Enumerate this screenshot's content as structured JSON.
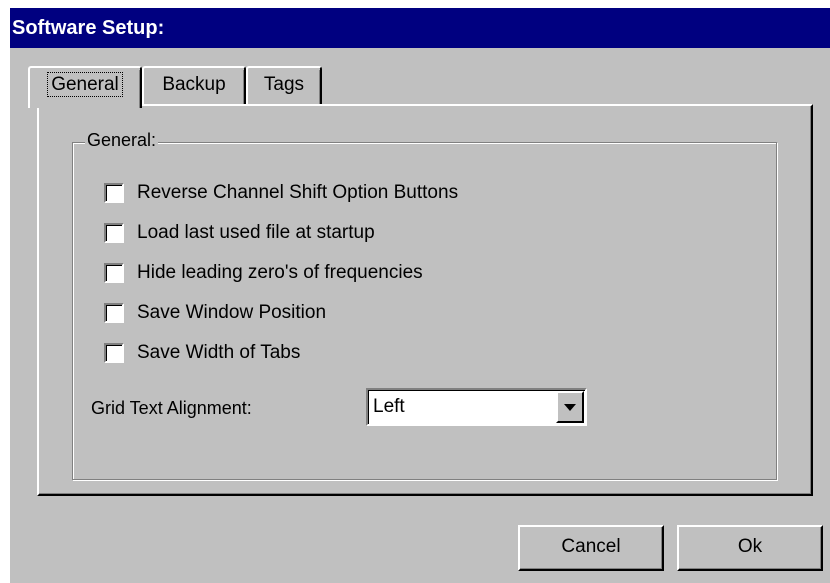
{
  "window": {
    "title": "Software Setup:"
  },
  "tabs": [
    {
      "label": "General",
      "active": true
    },
    {
      "label": "Backup",
      "active": false
    },
    {
      "label": "Tags",
      "active": false
    }
  ],
  "general": {
    "group_title": "General:",
    "options": [
      {
        "label": "Reverse Channel Shift Option Buttons",
        "checked": false
      },
      {
        "label": "Load last used file at startup",
        "checked": false
      },
      {
        "label": "Hide leading zero's of frequencies",
        "checked": false
      },
      {
        "label": "Save Window Position",
        "checked": false
      },
      {
        "label": "Save Width of Tabs",
        "checked": false
      }
    ],
    "alignment_label": "Grid Text Alignment:",
    "alignment_value": "Left"
  },
  "buttons": {
    "cancel": "Cancel",
    "ok": "Ok"
  },
  "colors": {
    "face": "#c0c0c0",
    "titlebar": "#000080",
    "title_text": "#ffffff"
  },
  "icons": {
    "dropdown_arrow": "chevron-down-icon"
  }
}
